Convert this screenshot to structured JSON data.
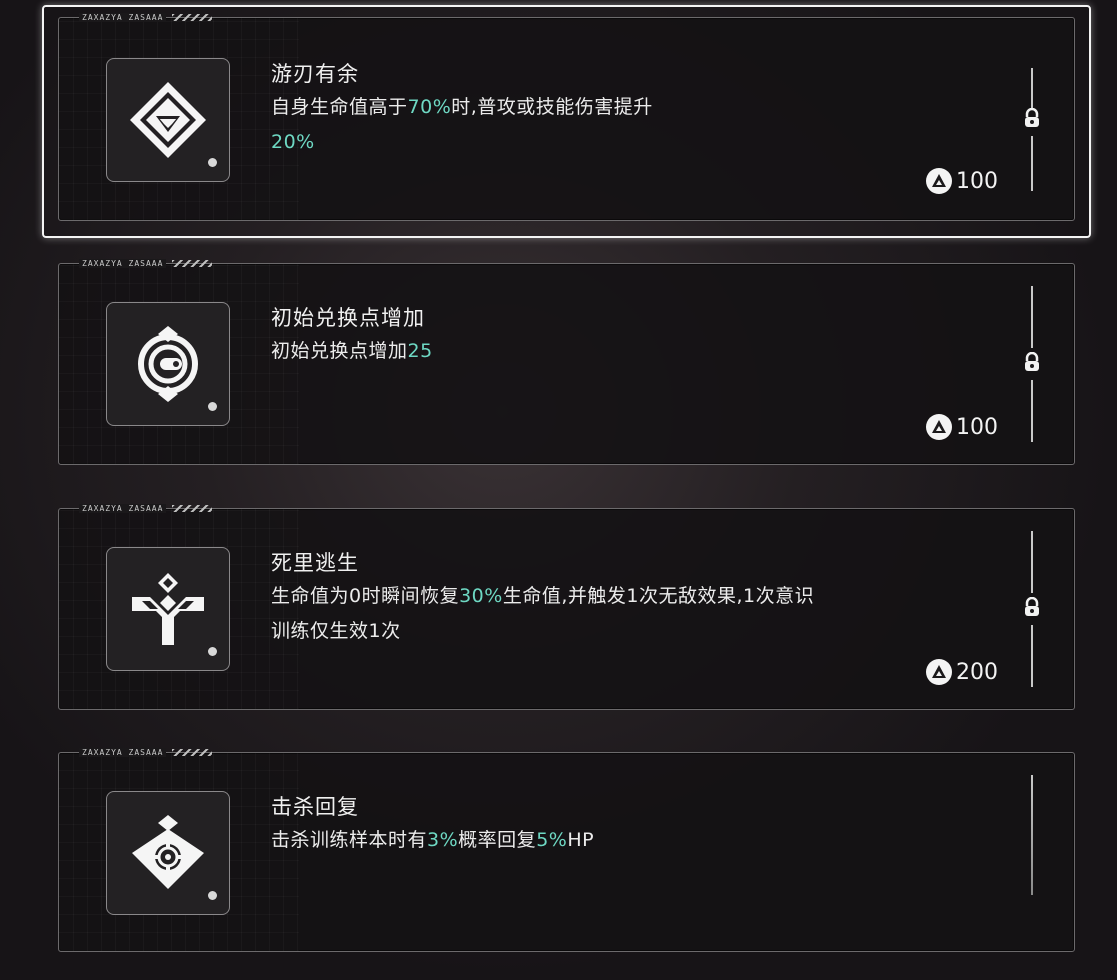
{
  "cards": [
    {
      "tab_code": "ZAXAZYA ZASAAA",
      "title": "游刃有余",
      "desc_parts": [
        "自身生命值高于",
        "70%",
        "时,普攻或技能伤害提升",
        "20%"
      ],
      "cost": "100",
      "icon": "diamond-gem-icon",
      "locked": true,
      "selected": true
    },
    {
      "tab_code": "ZAXAZYA ZASAAA",
      "title": "初始兑换点增加",
      "desc_parts": [
        "初始兑换点增加",
        "25"
      ],
      "cost": "100",
      "icon": "currency-shield-icon",
      "locked": true,
      "selected": false
    },
    {
      "tab_code": "ZAXAZYA ZASAAA",
      "title": "死里逃生",
      "desc_parts": [
        "生命值为0时瞬间恢复",
        "30%",
        "生命值,并触发1次无敌效果,1次意识训练仅生效1次"
      ],
      "cost": "200",
      "icon": "phoenix-rescue-icon",
      "locked": true,
      "selected": false
    },
    {
      "tab_code": "ZAXAZYA ZASAAA",
      "title": "击杀回复",
      "desc_parts": [
        "击杀训练样本时有",
        "3%",
        "概率回复",
        "5%",
        "HP"
      ],
      "cost": "",
      "icon": "crosshair-heart-icon",
      "locked": false,
      "selected": false
    }
  ],
  "colors": {
    "highlight": "#6ed8c3",
    "text": "#ececec",
    "card_border": "#6c6a6c",
    "selected_border": "#f4f4f4"
  }
}
